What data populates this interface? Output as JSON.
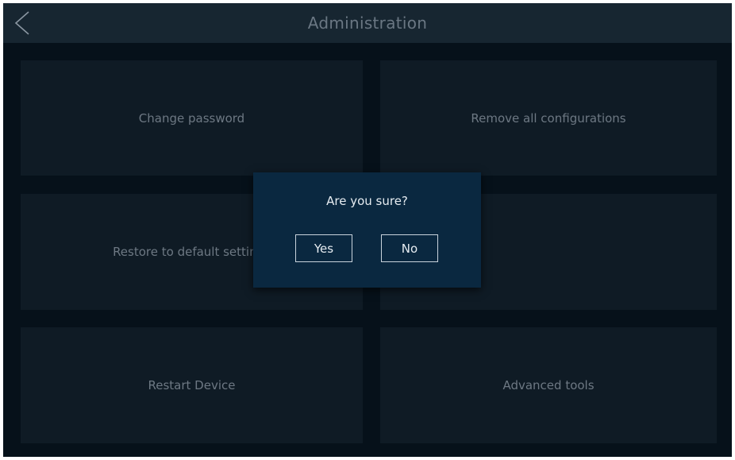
{
  "header": {
    "title": "Administration",
    "back_icon": "chevron-left-icon"
  },
  "tiles": [
    {
      "label": "Change password"
    },
    {
      "label": "Remove all configurations"
    },
    {
      "label": "Restore to default settings"
    },
    {
      "label": ""
    },
    {
      "label": "Restart Device"
    },
    {
      "label": "Advanced tools"
    }
  ],
  "dialog": {
    "message": "Are you sure?",
    "yes_label": "Yes",
    "no_label": "No"
  },
  "colors": {
    "background": "#06111a",
    "topbar": "#172631",
    "tile": "#0f1b25",
    "dialog": "#0a2840",
    "tile_text": "#6d7883",
    "dialog_text": "#e6ecf1"
  }
}
